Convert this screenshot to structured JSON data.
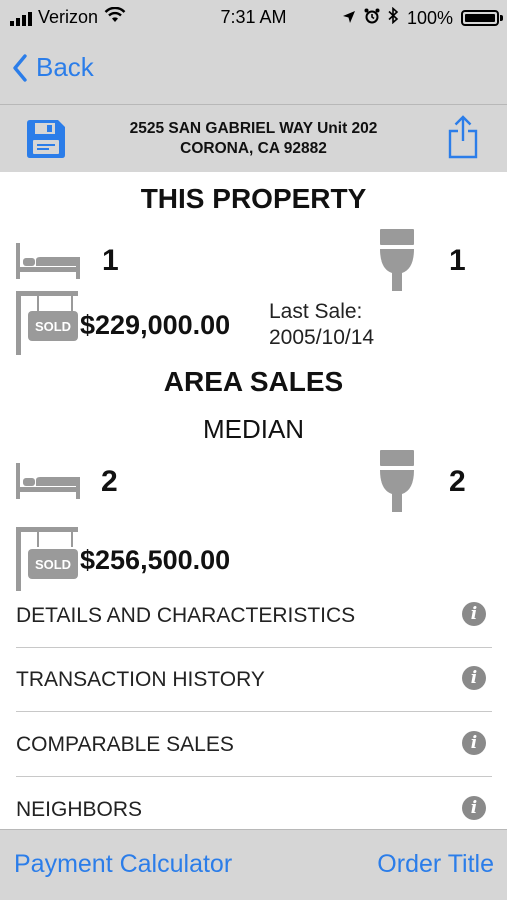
{
  "status_bar": {
    "carrier": "Verizon",
    "time": "7:31 AM",
    "battery": "100%",
    "battery_level": 1.0,
    "icons": [
      "signal-icon",
      "wifi-icon",
      "location-icon",
      "alarm-icon",
      "bluetooth-icon",
      "battery-icon"
    ]
  },
  "nav": {
    "back_label": "Back",
    "back_icon": "chevron-left-icon"
  },
  "address": {
    "line1": "2525 SAN GABRIEL WAY Unit 202",
    "line2": "CORONA, CA 92882",
    "save_icon": "floppy-disk-icon",
    "share_icon": "share-icon"
  },
  "this_property": {
    "title": "THIS PROPERTY",
    "beds": "1",
    "baths": "1",
    "price": "$229,000.00",
    "last_sale_label": "Last Sale:",
    "last_sale_date": "2005/10/14",
    "sold_sign_text": "SOLD"
  },
  "area_sales": {
    "title": "AREA SALES",
    "subtitle": "MEDIAN",
    "beds": "2",
    "baths": "2",
    "price": "$256,500.00",
    "sold_sign_text": "SOLD"
  },
  "sections": [
    {
      "label": "DETAILS AND CHARACTERISTICS"
    },
    {
      "label": "TRANSACTION HISTORY"
    },
    {
      "label": "COMPARABLE SALES"
    },
    {
      "label": "NEIGHBORS"
    }
  ],
  "toolbar": {
    "left_label": "Payment Calculator",
    "right_label": "Order Title"
  },
  "colors": {
    "accent": "#2b7de9",
    "bar_bg": "#d6d6d6",
    "icon_gray": "#9a9a9a"
  }
}
